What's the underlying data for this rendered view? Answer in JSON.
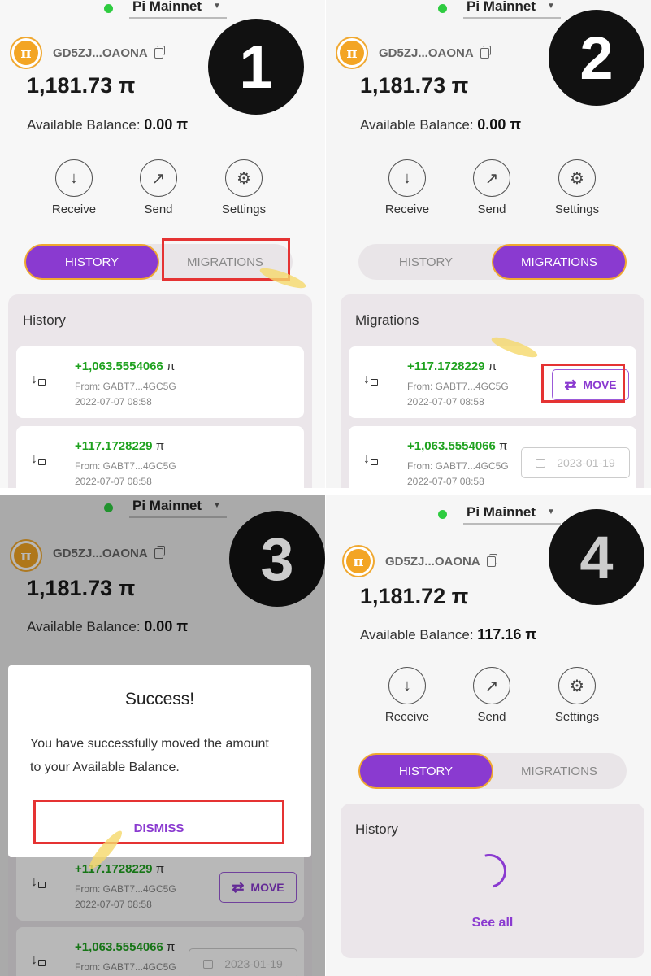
{
  "network": "Pi Mainnet",
  "wallet_address": "GD5ZJ...OAONA",
  "actions": {
    "receive": "Receive",
    "send": "Send",
    "settings": "Settings"
  },
  "tabs": {
    "history": "HISTORY",
    "migrations": "MIGRATIONS"
  },
  "available_label": "Available Balance:",
  "pi_symbol": "π",
  "colors": {
    "accent": "#8a3ad0",
    "amount_green": "#1fa21f",
    "highlight_red": "#e53333",
    "online_dot": "#2ecc40",
    "logo_gold": "#f3a524"
  },
  "panels": [
    {
      "step": "1",
      "balance": "1,181.73 π",
      "available": "0.00 π",
      "active_tab": "history",
      "card_title": "History",
      "rows": [
        {
          "amount": "+1,063.5554066",
          "from": "From: GABT7...4GC5G",
          "date": "2022-07-07 08:58"
        },
        {
          "amount": "+117.1728229",
          "from": "From: GABT7...4GC5G",
          "date": "2022-07-07 08:58"
        }
      ]
    },
    {
      "step": "2",
      "balance": "1,181.73 π",
      "available": "0.00 π",
      "active_tab": "migrations",
      "card_title": "Migrations",
      "rows": [
        {
          "amount": "+117.1728229",
          "from": "From: GABT7...4GC5G",
          "date": "2022-07-07 08:58",
          "button": "MOVE"
        },
        {
          "amount": "+1,063.5554066",
          "from": "From: GABT7...4GC5G",
          "date": "2022-07-07 08:58",
          "locked_until": "2023-01-19"
        }
      ]
    },
    {
      "step": "3",
      "balance": "1,181.73 π",
      "available": "0.00 π",
      "modal": {
        "title": "Success!",
        "message": "You have successfully moved the amount to your Available Balance.",
        "dismiss": "DISMISS"
      },
      "rows": [
        {
          "amount": "+117.1728229",
          "from": "From: GABT7...4GC5G",
          "date": "2022-07-07 08:58",
          "button": "MOVE"
        },
        {
          "amount": "+1,063.5554066",
          "from": "From: GABT7...4GC5G",
          "date": "",
          "locked_until": "2023-01-19"
        }
      ]
    },
    {
      "step": "4",
      "balance": "1,181.72 π",
      "available": "117.16 π",
      "active_tab": "history",
      "card_title": "History",
      "see_all": "See all"
    }
  ]
}
